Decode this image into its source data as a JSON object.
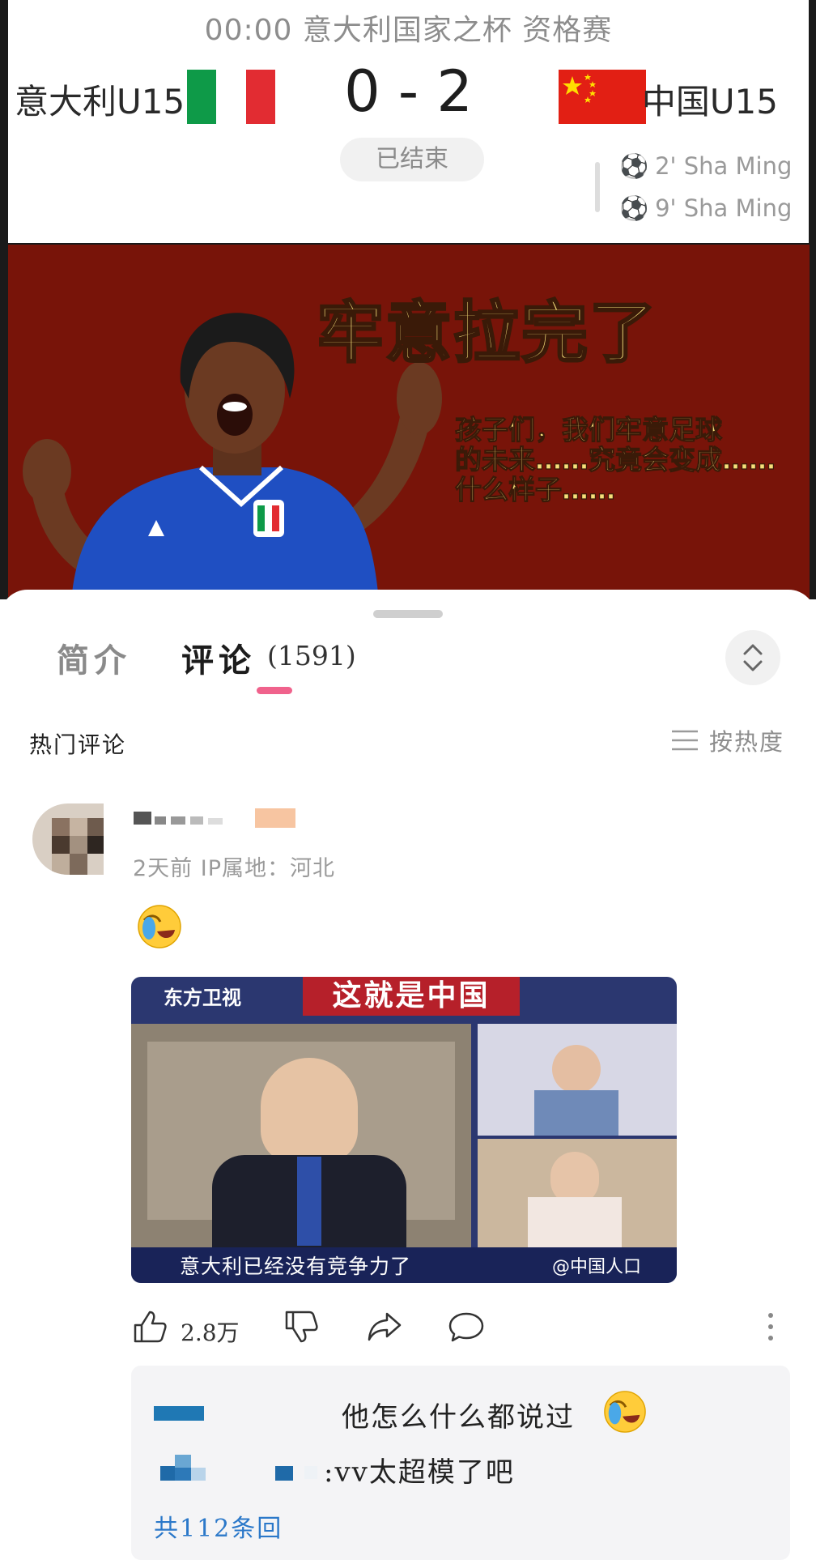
{
  "match": {
    "title": "00:00 意大利国家之杯 资格赛",
    "home_team": "意大利U15",
    "away_team": "中国U15",
    "score": "0 - 2",
    "status": "已结束",
    "goals": [
      "2' Sha Ming",
      "9' Sha Ming"
    ]
  },
  "meme": {
    "headline": "牢意拉完了",
    "caption_lines": [
      "孩子们，我们牢意足球",
      "的未来……究竟会变成……",
      "什么样子……"
    ]
  },
  "tabs": {
    "intro": "简介",
    "comments": "评论",
    "comment_count": "(1591)"
  },
  "comments_header": {
    "label": "热门评论",
    "sort": "按热度"
  },
  "comment": {
    "meta": "2天前 IP属地：河北",
    "image": {
      "logo": "东方卫视",
      "banner": "这就是中国",
      "subtitle": "意大利已经没有竞争力了",
      "watermark": "@中国人口"
    },
    "likes": "2.8万"
  },
  "replies": {
    "first_text": "他怎么什么都说过",
    "second_text": ":vv太超模了吧",
    "view_all": "共112条回"
  },
  "colors": {
    "accent_pink": "#f0628c",
    "link_blue": "#2b78c9",
    "meme_bg": "#781409",
    "meme_text": "#f6df7a"
  }
}
